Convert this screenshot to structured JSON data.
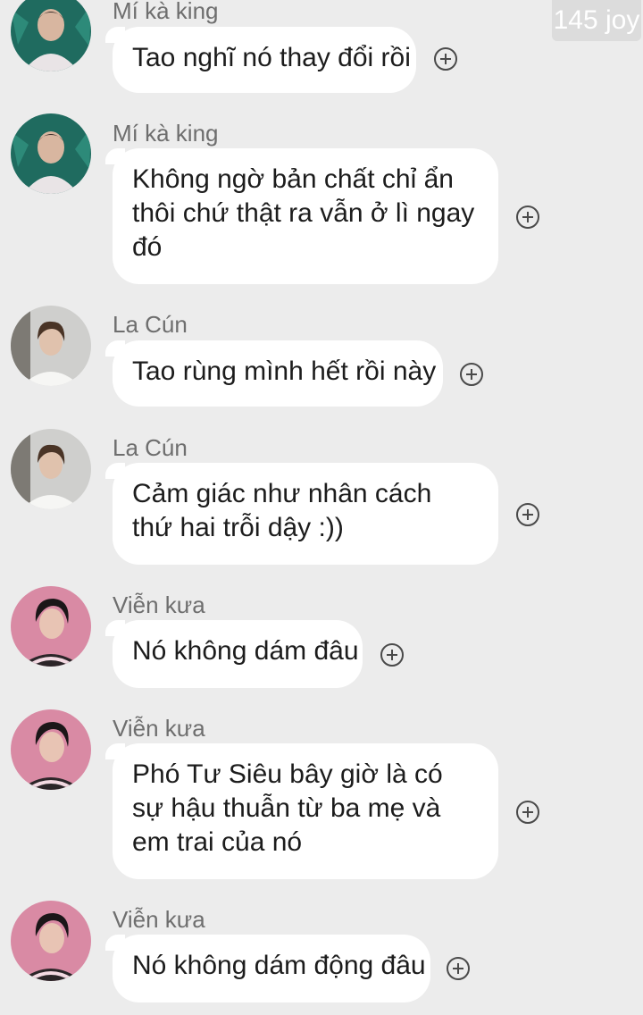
{
  "badge": {
    "text": "145 joy"
  },
  "messages": [
    {
      "sender": "Mí kà king",
      "text": "Tao nghĩ nó thay đổi rồi",
      "avatar": "avatar-mi-ka-king"
    },
    {
      "sender": "Mí kà king",
      "text": "Không ngờ bản chất chỉ ẩn thôi chứ thật ra vẫn ở lì ngay đó",
      "avatar": "avatar-mi-ka-king"
    },
    {
      "sender": "La Cún",
      "text": "Tao rùng mình hết rồi này",
      "avatar": "avatar-la-cun"
    },
    {
      "sender": "La Cún",
      "text": "Cảm giác như nhân cách thứ hai trỗi dậy :))",
      "avatar": "avatar-la-cun"
    },
    {
      "sender": "Viễn kưa",
      "text": "Nó không dám đâu",
      "avatar": "avatar-vien-kua"
    },
    {
      "sender": "Viễn kưa",
      "text": "Phó Tư Siêu bây giờ là có sự hậu thuẫn từ ba mẹ và em trai của nó",
      "avatar": "avatar-vien-kua"
    },
    {
      "sender": "Viễn kưa",
      "text": "Nó không dám động đâu",
      "avatar": "avatar-vien-kua"
    }
  ],
  "icons": {
    "reaction": "add-reaction-icon"
  },
  "colors": {
    "background": "#ececec",
    "bubble": "#ffffff",
    "sender": "#6e6e6e"
  }
}
